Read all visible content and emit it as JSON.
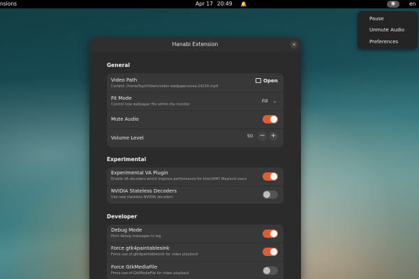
{
  "topbar": {
    "activities": "nsions",
    "date": "Apr 17",
    "time": "20:49",
    "bell_glyph": "🔔",
    "tray_glyph": "✱",
    "lang": "en"
  },
  "popup_menu": {
    "items": [
      "Pause",
      "Unmute Audio",
      "Preferences"
    ]
  },
  "window": {
    "title": "Hanabi Extension",
    "close_glyph": "×"
  },
  "sections": {
    "general": {
      "title": "General",
      "video_path": {
        "title": "Video Path",
        "subtitle": "Current: /home/fopt/Videos/video-wallpapers/sea-24216.mp4",
        "button": "Open"
      },
      "fit_mode": {
        "title": "Fit Mode",
        "subtitle": "Control how wallpaper fits within the monitor",
        "value": "Fill",
        "chevron": "⌄"
      },
      "mute_audio": {
        "title": "Mute Audio",
        "on": true
      },
      "volume_level": {
        "title": "Volume Level",
        "value": "50",
        "minus": "−",
        "plus": "+"
      }
    },
    "experimental": {
      "title": "Experimental",
      "va_plugin": {
        "title": "Experimental VA Plugin",
        "subtitle": "Enable VA decoders which improve performance for Intel/AMD Wayland users",
        "on": true
      },
      "nvidia": {
        "title": "NVIDIA Stateless Decoders",
        "subtitle": "Use new stateless NVIDIA decoders",
        "on": false
      }
    },
    "developer": {
      "title": "Developer",
      "debug_mode": {
        "title": "Debug Mode",
        "subtitle": "Print debug messages to log",
        "on": true
      },
      "gtk4paintablesink": {
        "title": "Force gtk4paintablesink",
        "subtitle": "Force use of gtk4paintablesink for video playback",
        "on": true
      },
      "gtkmediafile": {
        "title": "Force GtkMediaFile",
        "subtitle": "Force use of GtkMediaFile for video playback",
        "on": false
      }
    }
  },
  "colors": {
    "accent": "#e05d33",
    "window_bg": "#2b2b2b",
    "card_bg": "#383838",
    "topbar_bg": "#000000"
  }
}
